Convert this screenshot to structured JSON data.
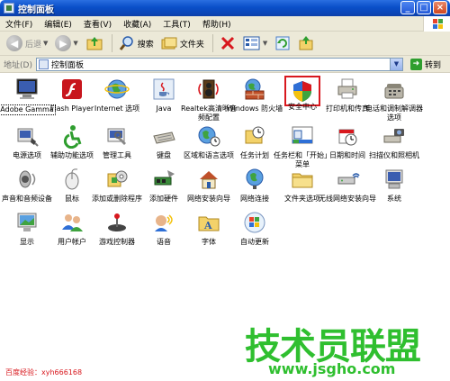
{
  "window": {
    "title": "控制面板"
  },
  "window_buttons": {
    "minimize": "_",
    "maximize": "□",
    "close": "×"
  },
  "menu": [
    "文件(F)",
    "编辑(E)",
    "查看(V)",
    "收藏(A)",
    "工具(T)",
    "帮助(H)"
  ],
  "toolbar": {
    "back": "后退",
    "search": "搜索",
    "folders": "文件夹"
  },
  "address": {
    "label": "地址(D)",
    "value": "控制面板",
    "go": "转到"
  },
  "items": [
    "Adobe Gamma",
    "Flash Player",
    "Internet 选项",
    "Java",
    "Realtek高清晰音频配置",
    "Windows 防火墙",
    "安全中心",
    "打印机和传真",
    "电话和调制解调器选项",
    "电源选项",
    "辅助功能选项",
    "管理工具",
    "键盘",
    "区域和语言选项",
    "任务计划",
    "任务栏和「开始」菜单",
    "日期和时间",
    "扫描仪和照相机",
    "声音和音频设备",
    "鼠标",
    "添加或删除程序",
    "添加硬件",
    "网络安装向导",
    "网络连接",
    "文件夹选项",
    "无线网络安装向导",
    "系统",
    "显示",
    "用户帐户",
    "游戏控制器",
    "语音",
    "字体",
    "自动更新"
  ],
  "selected_item": "安全中心",
  "footer": {
    "caption": "百度经验：xyh666168"
  },
  "watermark": {
    "text1": "技术员联盟",
    "text2": "www.jsgho.com"
  },
  "colors": {
    "title_bar": "#0a4fc8",
    "selection_box": "#d8181e",
    "watermark": "#2fbf2f"
  }
}
